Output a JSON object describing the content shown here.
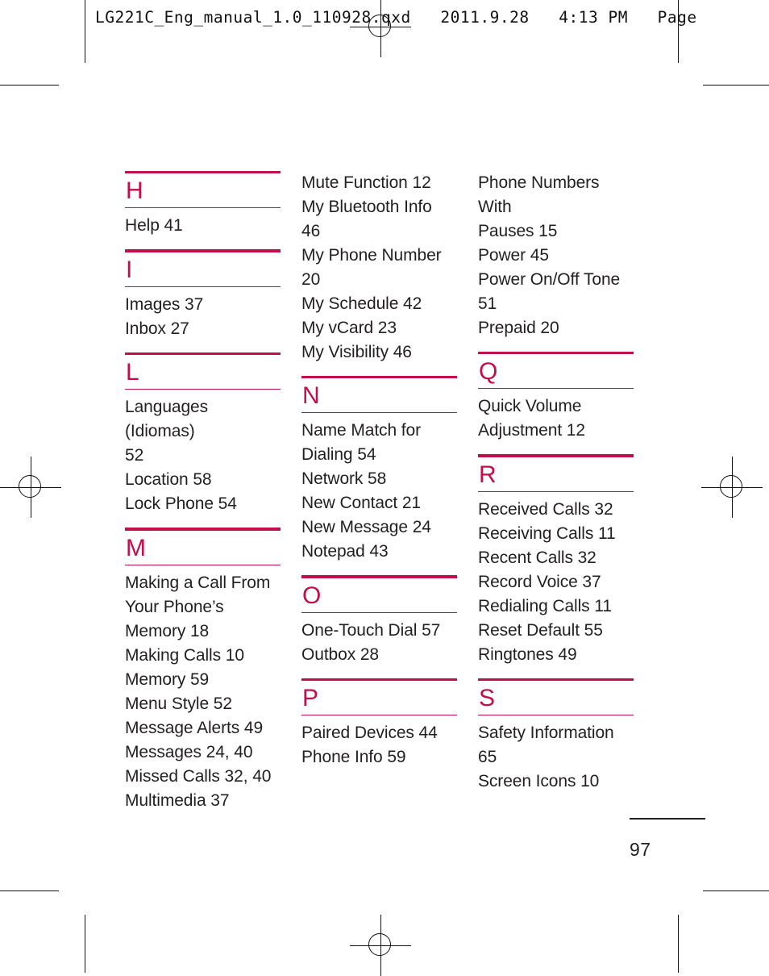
{
  "print_header": {
    "text": "LG221C_Eng_manual_1.0_110928.qxd   2011.9.28   4:13 PM   Page"
  },
  "accent_color": "#C30E4C",
  "text_color": "#231f20",
  "folio": {
    "page_number": "97"
  },
  "columns": [
    {
      "id": "column-1",
      "lead_entries": [],
      "sections": [
        {
          "letter": "H",
          "entries": [
            "Help 41"
          ]
        },
        {
          "letter": "I",
          "entries": [
            "Images 37",
            "Inbox 27"
          ]
        },
        {
          "letter": "L",
          "entries": [
            "Languages (Idiomas)",
            "52",
            "Location 58",
            "Lock Phone 54"
          ]
        },
        {
          "letter": "M",
          "entries": [
            "Making a Call From",
            "Your Phone’s",
            "Memory 18",
            "Making Calls 10",
            "Memory 59",
            "Menu Style 52",
            "Message Alerts 49",
            "Messages 24, 40",
            "Missed Calls 32, 40",
            "Multimedia 37"
          ]
        }
      ]
    },
    {
      "id": "column-2",
      "lead_entries": [
        "Mute Function 12",
        "My Bluetooth Info",
        "46",
        "My Phone Number",
        "20",
        "My Schedule 42",
        "My vCard 23",
        "My Visibility 46"
      ],
      "sections": [
        {
          "letter": "N",
          "entries": [
            "Name Match for",
            "Dialing 54",
            "Network 58",
            "New Contact 21",
            "New Message 24",
            "Notepad 43"
          ]
        },
        {
          "letter": "O",
          "entries": [
            "One-Touch Dial 57",
            "Outbox 28"
          ]
        },
        {
          "letter": "P",
          "entries": [
            "Paired Devices 44",
            "Phone Info 59"
          ]
        }
      ]
    },
    {
      "id": "column-3",
      "lead_entries": [
        "Phone Numbers With",
        "Pauses 15",
        "Power 45",
        "Power On/Off Tone",
        "51",
        "Prepaid 20"
      ],
      "sections": [
        {
          "letter": "Q",
          "entries": [
            "Quick Volume",
            "Adjustment 12"
          ]
        },
        {
          "letter": "R",
          "entries": [
            "Received Calls 32",
            "Receiving Calls 11",
            "Recent Calls 32",
            "Record Voice 37",
            "Redialing Calls 11",
            "Reset Default 55",
            "Ringtones 49"
          ]
        },
        {
          "letter": "S",
          "entries": [
            "Safety Information",
            "65",
            "Screen Icons 10"
          ]
        }
      ]
    }
  ]
}
